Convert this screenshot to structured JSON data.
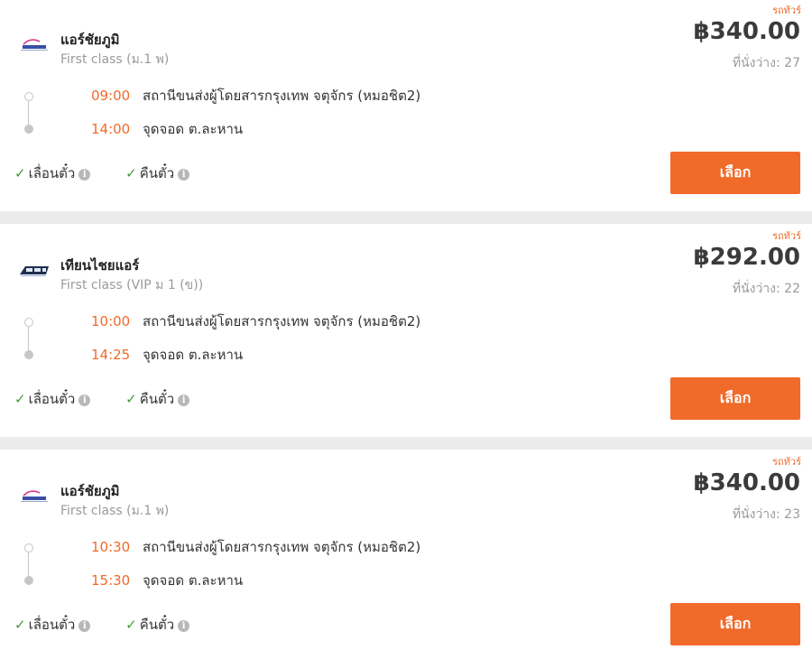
{
  "results": [
    {
      "bus_type": "รถทัวร์",
      "operator": "แอร์ชัยภูมิ",
      "logo": "airchaiyaphum-logo",
      "seat_class": "First class (ม.1 พ)",
      "price": "฿340.00",
      "seats_available": "ที่นั่งว่าง: 27",
      "departure": {
        "time": "09:00",
        "place": "สถานีขนส่งผู้โดยสารกรุงเทพ จตุจักร (หมอชิต2)"
      },
      "arrival": {
        "time": "14:00",
        "place": "จุดจอด ต.ละหาน"
      },
      "policies": [
        "เลื่อนตั๋ว",
        "คืนตั๋ว"
      ],
      "select_label": "เลือก"
    },
    {
      "bus_type": "รถทัวร์",
      "operator": "เทียนไชยแอร์",
      "logo": "tienchaiair-logo",
      "seat_class": "First class (VIP ม 1 (ข))",
      "price": "฿292.00",
      "seats_available": "ที่นั่งว่าง: 22",
      "departure": {
        "time": "10:00",
        "place": "สถานีขนส่งผู้โดยสารกรุงเทพ จตุจักร (หมอชิต2)"
      },
      "arrival": {
        "time": "14:25",
        "place": "จุดจอด ต.ละหาน"
      },
      "policies": [
        "เลื่อนตั๋ว",
        "คืนตั๋ว"
      ],
      "select_label": "เลือก"
    },
    {
      "bus_type": "รถทัวร์",
      "operator": "แอร์ชัยภูมิ",
      "logo": "airchaiyaphum-logo",
      "seat_class": "First class (ม.1 พ)",
      "price": "฿340.00",
      "seats_available": "ที่นั่งว่าง: 23",
      "departure": {
        "time": "10:30",
        "place": "สถานีขนส่งผู้โดยสารกรุงเทพ จตุจักร (หมอชิต2)"
      },
      "arrival": {
        "time": "15:30",
        "place": "จุดจอด ต.ละหาน"
      },
      "policies": [
        "เลื่อนตั๋ว",
        "คืนตั๋ว"
      ],
      "select_label": "เลือก"
    }
  ],
  "colors": {
    "accent": "#f06a29",
    "check": "#3f9c35",
    "muted": "#9a9a9a",
    "price": "#3b3b3b"
  }
}
